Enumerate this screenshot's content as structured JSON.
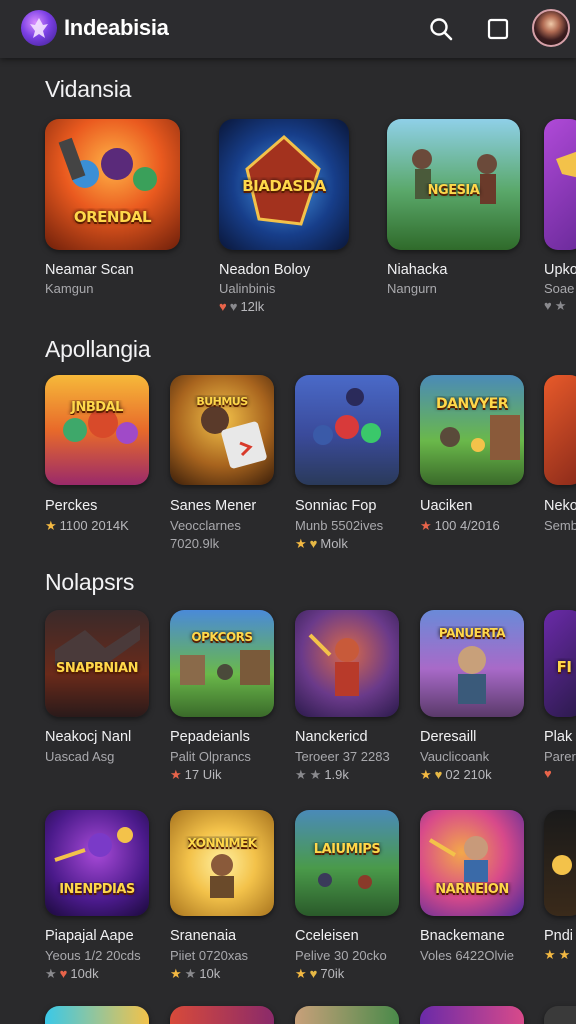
{
  "app": {
    "title": "Indeabisia"
  },
  "header": {
    "logo_icon": "app-logo-icon",
    "search_icon": "search-icon",
    "window_icon": "square-icon",
    "avatar_icon": "avatar"
  },
  "colors": {
    "background": "#2a2a2c",
    "appbar": "#2c2c2f",
    "star": "#f4b942",
    "heart": "#e8644a"
  },
  "sections": [
    {
      "title": "Vidansia",
      "items": [
        {
          "name": "Neamar Scan",
          "sub": "Kamgun",
          "meta": "",
          "caption": "ORENDAL"
        },
        {
          "name": "Neadon Boloy",
          "sub": "Ualinbinis",
          "meta": "12lk",
          "caption": "BIADASDA"
        },
        {
          "name": "Niahacka",
          "sub": "Nangurn",
          "meta": "",
          "caption": "NGESIA"
        },
        {
          "name": "Upko",
          "sub": "Soae",
          "meta": "",
          "caption": ""
        }
      ]
    },
    {
      "title": "Apollangia",
      "items": [
        {
          "name": "Perckes",
          "sub": "",
          "meta": "1100 2014K",
          "caption": "JNBDAL"
        },
        {
          "name": "Sanes Mener",
          "sub": "Veocclarnes",
          "meta": "7020.9lk",
          "caption": "BUHMUS"
        },
        {
          "name": "Sonniac Fop",
          "sub": "Munb 5502ives",
          "meta": "Molk",
          "caption": ""
        },
        {
          "name": "Uaciken",
          "sub": "",
          "meta": "100 4/2016",
          "caption": "DANVYER"
        },
        {
          "name": "Neko",
          "sub": "Semb",
          "meta": "",
          "caption": ""
        }
      ]
    },
    {
      "title": "Nolapsrs",
      "items": [
        {
          "name": "Neakocj Nanl",
          "sub": "Uascad Asg",
          "meta": "",
          "caption": "SNAPBNIAN"
        },
        {
          "name": "Pepadeianls",
          "sub": "Palit Olprancs",
          "meta": "17 Uik",
          "caption": "OPKCORS"
        },
        {
          "name": "Nanckericd",
          "sub": "Teroeer 37 2283",
          "meta": "1.9k",
          "caption": ""
        },
        {
          "name": "Deresaill",
          "sub": "Vauclicoank",
          "meta": "02 210k",
          "caption": "PANUERTA"
        },
        {
          "name": "Plak",
          "sub": "Parer",
          "meta": "",
          "caption": "FI"
        }
      ]
    },
    {
      "title": "",
      "items": [
        {
          "name": "Piapajal Aape",
          "sub": "Yeous 1/2 20cds",
          "meta": "10dk",
          "caption": "INENPDIAS"
        },
        {
          "name": "Sranenaia",
          "sub": "Piiet 0720xas",
          "meta": "10k",
          "caption": "XONNIMEK"
        },
        {
          "name": "Cceleisen",
          "sub": "Pelive 30 20cko",
          "meta": "70ik",
          "caption": "LAIUMIPS"
        },
        {
          "name": "Bnackemane",
          "sub": "Voles 6422Olvie",
          "meta": "",
          "caption": "NARNEION"
        },
        {
          "name": "Pndi",
          "sub": "",
          "meta": "",
          "caption": ""
        }
      ]
    }
  ]
}
